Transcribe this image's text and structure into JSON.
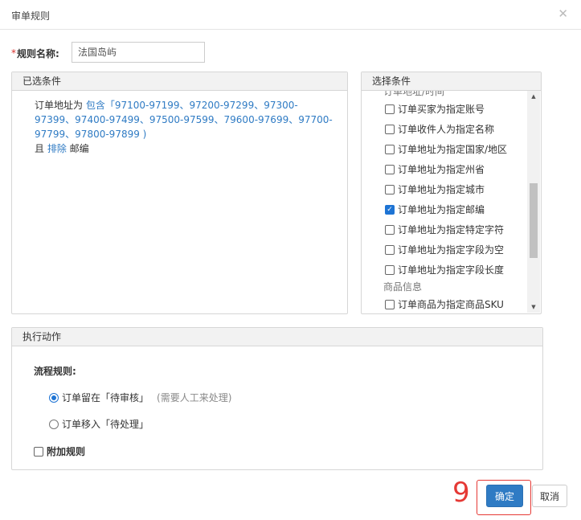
{
  "dialog": {
    "title": "审单规则"
  },
  "rule_name": {
    "required_mark": "*",
    "label": "规则名称:",
    "value": "法国岛屿"
  },
  "selected_panel": {
    "header": "已选条件",
    "line1_prefix": "订单地址为 ",
    "line1_op": "包含",
    "line1_values": "「97100-97199、97200-97299、97300-97399、97400-97499、97500-97599、79600-97699、97700-97799、97800-97899 )",
    "line2_prefix": "且 ",
    "line2_op": "排除",
    "line2_suffix": " 邮编"
  },
  "conditions_panel": {
    "header": "选择条件",
    "group_top": "订单地址/时间",
    "items": [
      {
        "label": "订单买家为指定账号",
        "checked": false
      },
      {
        "label": "订单收件人为指定名称",
        "checked": false
      },
      {
        "label": "订单地址为指定国家/地区",
        "checked": false
      },
      {
        "label": "订单地址为指定州省",
        "checked": false
      },
      {
        "label": "订单地址为指定城市",
        "checked": false
      },
      {
        "label": "订单地址为指定邮编",
        "checked": true
      },
      {
        "label": "订单地址为指定特定字符",
        "checked": false
      },
      {
        "label": "订单地址为指定字段为空",
        "checked": false
      },
      {
        "label": "订单地址为指定字段长度",
        "checked": false
      }
    ],
    "group_product": "商品信息",
    "product_item": "订单商品为指定商品SKU"
  },
  "action_panel": {
    "header": "执行动作",
    "flow_label": "流程规则:",
    "option1": "订单留在「待审核」",
    "option1_hint": "(需要人工来处理)",
    "option2": "订单移入「待处理」",
    "extra_rule": "附加规则"
  },
  "buttons": {
    "confirm": "确定",
    "cancel": "取消"
  },
  "annotation": {
    "step": "9",
    "color": "#e53935"
  },
  "colors": {
    "accent": "#2f7bc4",
    "link": "#2f7bc4"
  }
}
